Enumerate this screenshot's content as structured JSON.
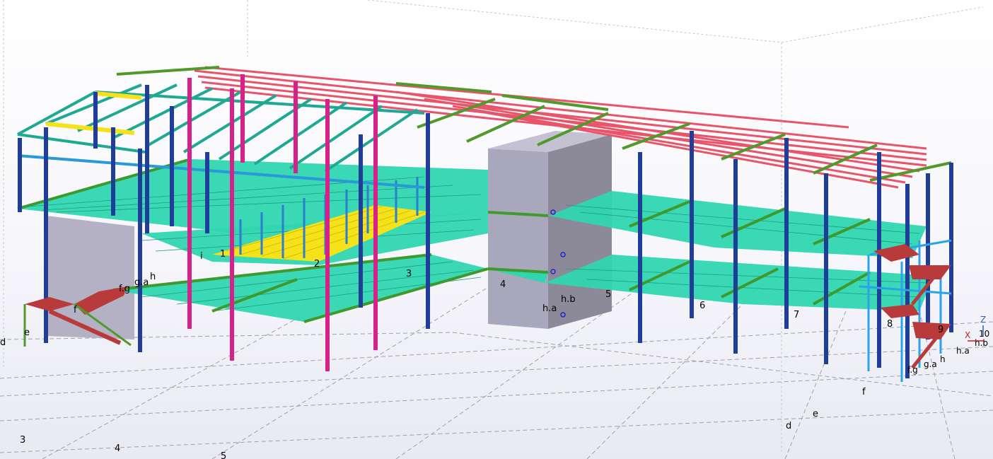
{
  "grid_labels_near": [
    "1",
    "2",
    "3",
    "4",
    "5",
    "6",
    "7",
    "8",
    "9",
    "10"
  ],
  "grid_labels_letters_left": [
    "i",
    "f.g",
    "g.a",
    "h",
    "f",
    "e",
    "d"
  ],
  "grid_labels_letters_right": [
    "h.a",
    "h.b",
    "h.a",
    "h.b",
    "f.g",
    "g.a",
    "h"
  ],
  "ground_labels_numbers": [
    "3",
    "4",
    "5"
  ],
  "ground_labels_letters": [
    "f",
    "e",
    "d"
  ],
  "axis": {
    "z": "Z",
    "x": "X"
  },
  "colors": {
    "column": "#1f3d99",
    "column_magenta": "#d6208a",
    "floor": "#2fd6b0",
    "roof_purlin": "#e8556a",
    "rafter": "#2e8a2e",
    "stair": "#b83a3a",
    "core": "#a8a6b8",
    "highlight": "#f5e21a"
  }
}
